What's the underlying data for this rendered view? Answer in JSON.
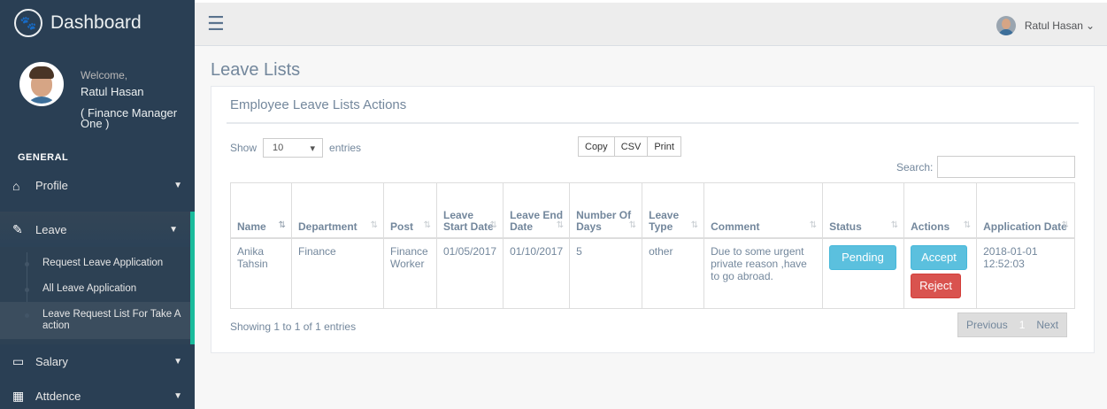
{
  "sidebar": {
    "brand": "Dashboard",
    "brand_icon": "paw-icon",
    "welcome": "Welcome,",
    "user_name": "Ratul Hasan",
    "user_role": "( Finance Manager One )",
    "section_title": "GENERAL",
    "items": [
      {
        "label": "Profile",
        "icon": "home-icon"
      },
      {
        "label": "Leave",
        "icon": "edit-icon"
      },
      {
        "label": "Salary",
        "icon": "desktop-icon"
      },
      {
        "label": "Attdence",
        "icon": "table-icon"
      }
    ],
    "leave_sub": [
      "Request Leave Application",
      "All Leave Application",
      "Leave Request List For Take A action"
    ]
  },
  "topnav": {
    "user_name": "Ratul Hasan",
    "caret": "⌄"
  },
  "page": {
    "title": "Leave Lists",
    "panel_title": "Employee Leave Lists Actions"
  },
  "controls": {
    "show_label": "Show",
    "show_value": "10",
    "entries_label": "entries",
    "buttons": [
      "Copy",
      "CSV",
      "Print"
    ],
    "search_label": "Search:"
  },
  "table": {
    "headers": [
      "Name",
      "Department",
      "Post",
      "Leave Start Date",
      "Leave End Date",
      "Number Of Days",
      "Leave Type",
      "Comment",
      "Status",
      "Actions",
      "Application Date"
    ],
    "rows": [
      {
        "name": "Anika Tahsin",
        "department": "Finance",
        "post": "Finance Worker",
        "start": "01/05/2017",
        "end": "01/10/2017",
        "days": "5",
        "type": "other",
        "comment": "Due to some urgent private reason ,have to go abroad.",
        "status": "Pending",
        "accept": "Accept",
        "reject": "Reject",
        "app_date": "2018-01-01 12:52:03"
      }
    ]
  },
  "footer": {
    "showing": "Showing 1 to 1 of 1 entries",
    "previous": "Previous",
    "page": "1",
    "next": "Next"
  },
  "colors": {
    "sidebar": "#2a3f54",
    "accent": "#1abb9c",
    "info": "#5bc0de",
    "danger": "#d9534f"
  }
}
